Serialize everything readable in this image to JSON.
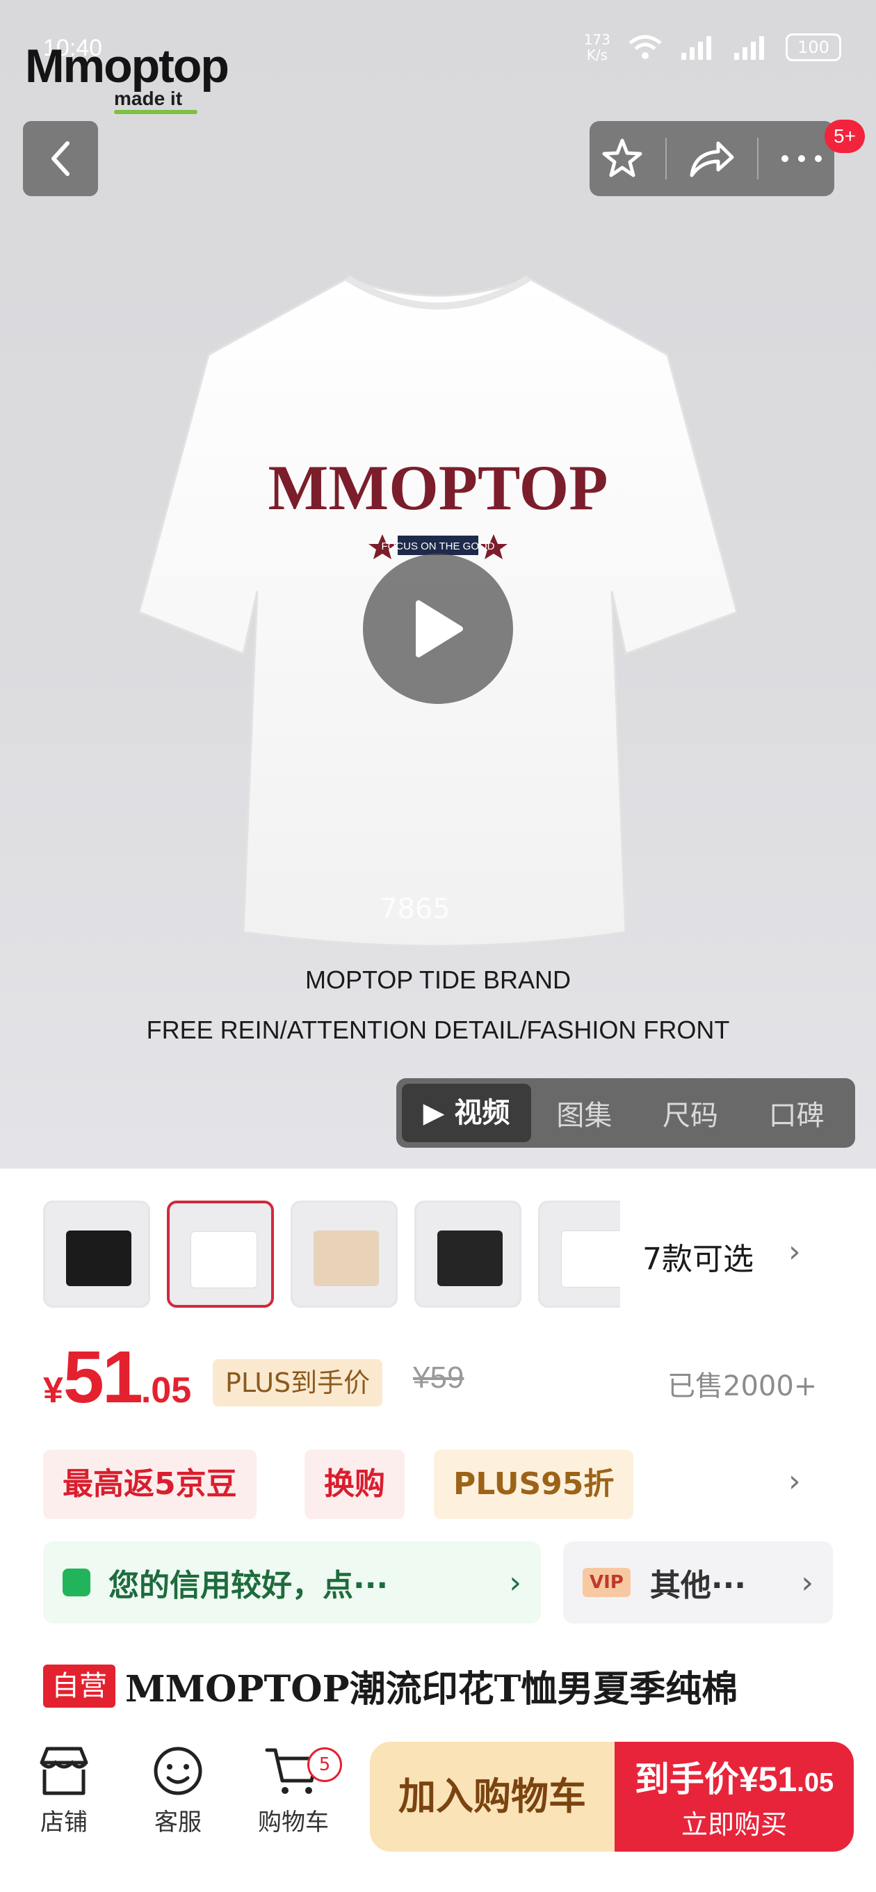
{
  "status_bar": {
    "time": "10:40",
    "speed_value": "173",
    "speed_unit": "K/s",
    "battery": "100"
  },
  "brand": {
    "logo_text": "Mmoptop",
    "tagline": "made it"
  },
  "header": {
    "notification_count": "5+"
  },
  "hero": {
    "watermark": "7865",
    "caption_line1": "MOPTOP TIDE BRAND",
    "caption_line2": "FREE REIN/ATTENTION DETAIL/FASHION FRONT",
    "print_text": "MMOPTOP",
    "print_subtext": "FOCUS ON THE GOOD",
    "media_tabs": [
      "▶ 视频",
      "图集",
      "尺码",
      "口碑"
    ]
  },
  "variants": {
    "label": "7款可选"
  },
  "price": {
    "currency": "¥",
    "integer": "51",
    "decimal": ".05",
    "plus_label": "PLUS到手价",
    "original": "¥59",
    "sold": "已售2000+"
  },
  "promos": [
    "最高返5京豆",
    "换购",
    "PLUS95折"
  ],
  "credit": {
    "text": "您的信用较好，点···",
    "vip_badge": "VIP",
    "vip_text": "其他···"
  },
  "product": {
    "tag": "自营",
    "title": "MMOPTOP潮流印花T恤男夏季纯棉"
  },
  "bottom_bar": {
    "shop": "店铺",
    "service": "客服",
    "cart": "购物车",
    "cart_count": "5",
    "add_to_cart": "加入购物车",
    "buy_price_label": "到手价",
    "buy_price": "¥51",
    "buy_price_decimal": ".05",
    "buy_now": "立即购买"
  },
  "colors": {
    "accent_red": "#e4212f",
    "plus_gold": "#fbe9cf",
    "credit_green": "#22b45a"
  }
}
